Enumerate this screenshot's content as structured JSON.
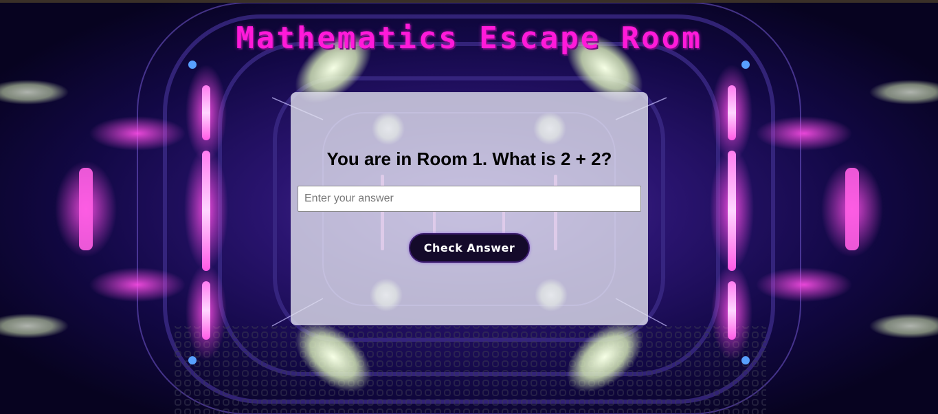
{
  "header": {
    "title": "Mathematics Escape Room"
  },
  "room": {
    "question": "You are in Room 1. What is 2 + 2?"
  },
  "answer": {
    "placeholder": "Enter your answer",
    "value": ""
  },
  "actions": {
    "check_label": "Check Answer"
  },
  "theme": {
    "title_color": "#ff1ad9",
    "button_bg": "#140a2a",
    "card_bg": "#e1e1ee",
    "neon_pink": "#ff3fe0",
    "neon_violet": "#7a2cff"
  },
  "background": {
    "scene": "neon-tunnel"
  }
}
